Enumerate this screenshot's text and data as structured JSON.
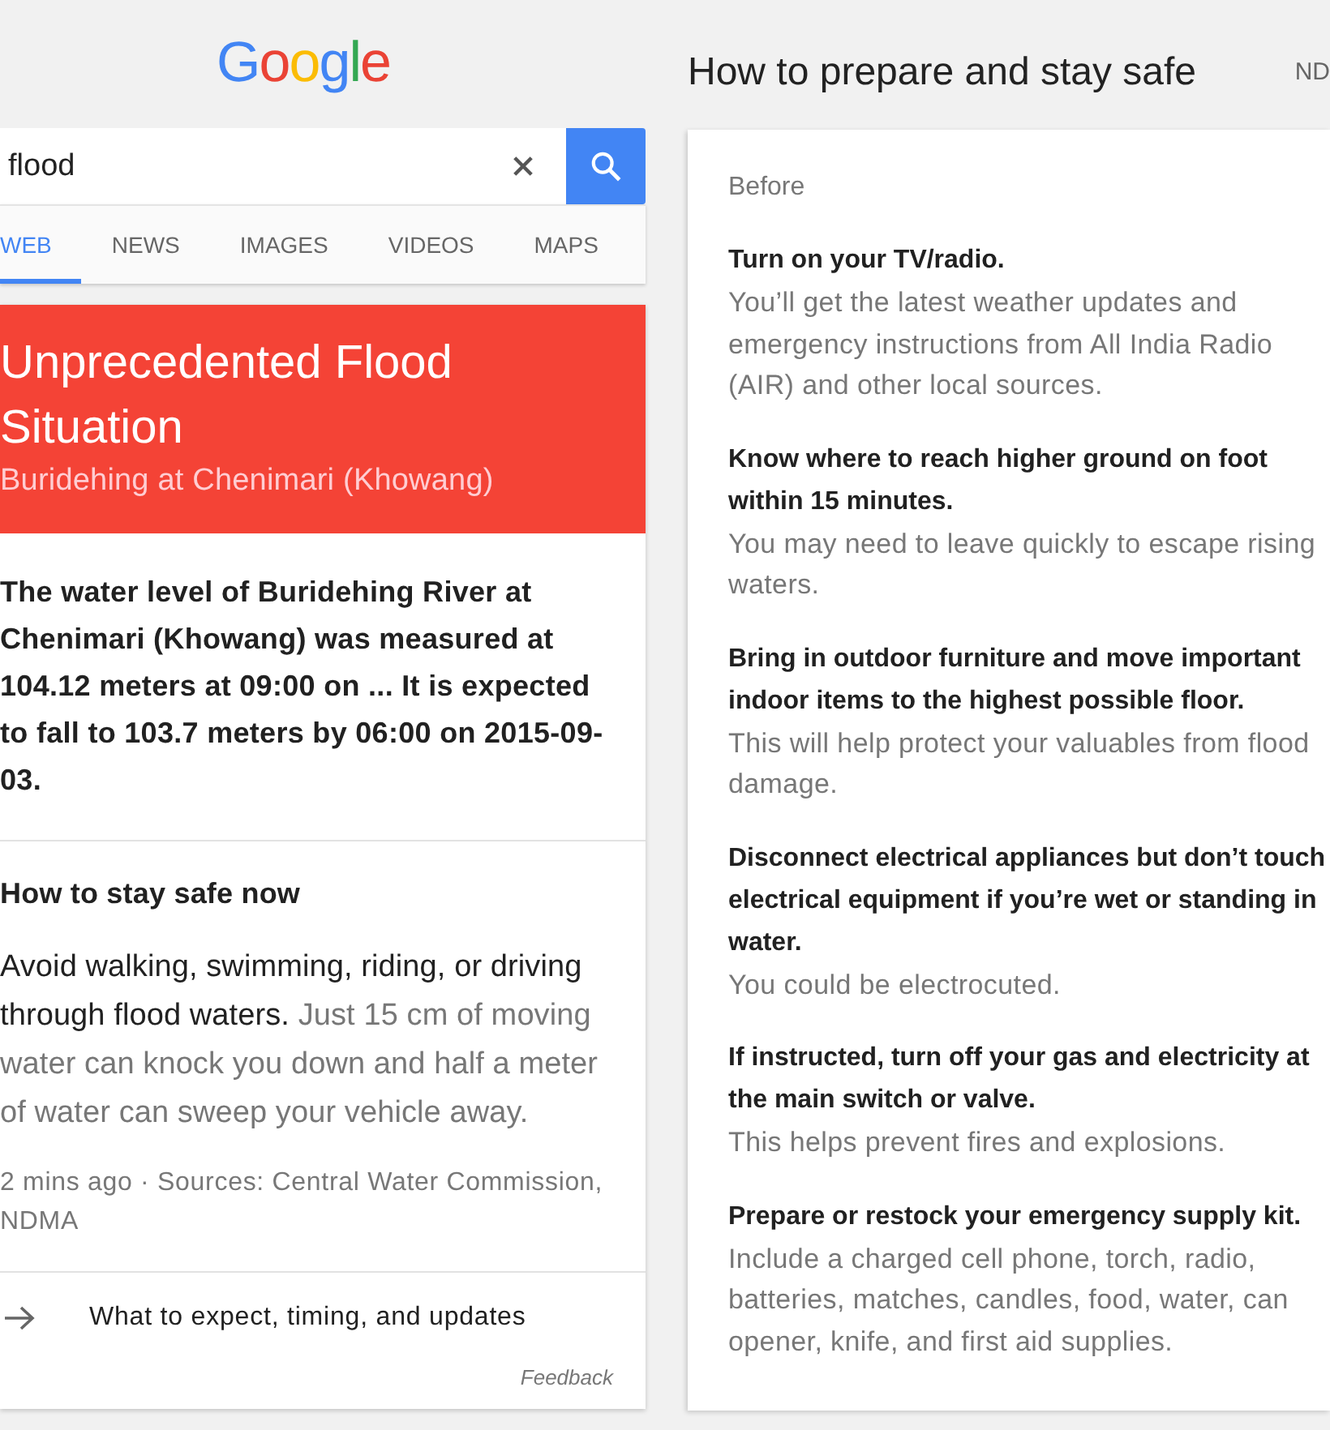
{
  "logo": {
    "letters": [
      {
        "text": "G",
        "color": "#4285f4"
      },
      {
        "text": "o",
        "color": "#ea4335"
      },
      {
        "text": "o",
        "color": "#fbbc05"
      },
      {
        "text": "g",
        "color": "#4285f4"
      },
      {
        "text": "l",
        "color": "#34a853"
      },
      {
        "text": "e",
        "color": "#ea4335"
      }
    ]
  },
  "search": {
    "value": "flood"
  },
  "tabs": [
    {
      "label": "WEB",
      "selected": true
    },
    {
      "label": "NEWS",
      "selected": false
    },
    {
      "label": "IMAGES",
      "selected": false
    },
    {
      "label": "VIDEOS",
      "selected": false
    },
    {
      "label": "MAPS",
      "selected": false
    }
  ],
  "alert": {
    "title": "Unprecedented Flood Situation",
    "subtitle": "Buridehing at Chenimari (Khowang)",
    "summary": "The water level of Buridehing River at Chenimari (Khowang) was measured at 104.12 meters at 09:00 on ... It is expected to fall to 103.7 meters by 06:00 on 2015-09-03."
  },
  "safety": {
    "heading": "How to stay safe now",
    "advice": "Avoid walking, swimming, riding, or driving through flood waters.",
    "detail": "Just 15 cm of moving water can knock you down and half a meter of water can sweep your vehicle away.",
    "sources": "2 mins ago · Sources: Central Water Commission, NDMA"
  },
  "more_link": {
    "label": "What to expect, timing, and updates"
  },
  "feedback": "Feedback",
  "prepare": {
    "title": "How to prepare and stay safe",
    "side_text": "ND",
    "phase": "Before",
    "steps": [
      {
        "title": "Turn on your TV/radio.",
        "detail": "You’ll get the latest weather updates and emergency instructions from All India Radio (AIR) and other local sources."
      },
      {
        "title": "Know where to reach higher ground on foot within 15 minutes.",
        "detail": "You may need to leave quickly to escape rising waters."
      },
      {
        "title": "Bring in outdoor furniture and move important indoor items to the highest possible floor.",
        "detail": "This will help protect your valuables from flood damage."
      },
      {
        "title": "Disconnect electrical appliances but don’t touch electrical equipment if you’re wet or standing in water.",
        "detail": "You could be electrocuted."
      },
      {
        "title": "If instructed, turn off your gas and electricity at the main switch or valve.",
        "detail": "This helps prevent fires and explosions."
      },
      {
        "title": "Prepare or restock your emergency supply kit.",
        "detail": "Include a charged cell phone, torch, radio, batteries, matches, candles, food, water, can opener, knife, and first aid supplies."
      }
    ]
  }
}
